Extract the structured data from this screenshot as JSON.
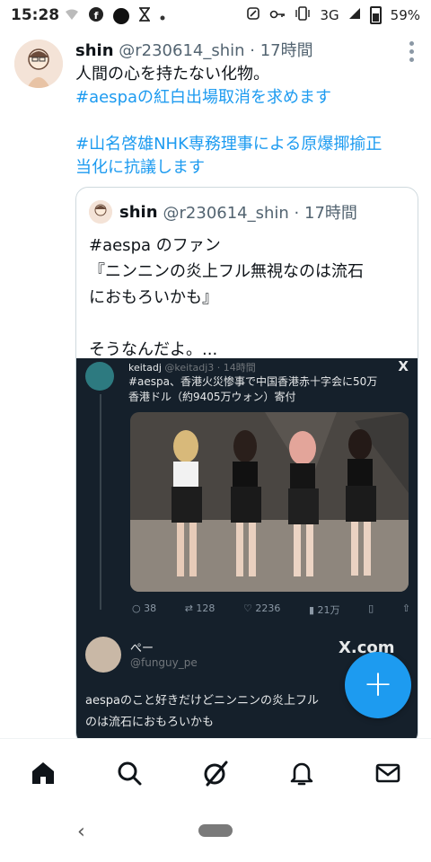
{
  "status_bar": {
    "time": "15:28",
    "network": "3G",
    "battery": "59%"
  },
  "tweet": {
    "author_name": "shin",
    "author_meta": "@r230614_shin · 17時間",
    "lines": [
      "人間の心を持たない化物。",
      "#aespaの紅白出場取消を求めます",
      "",
      "#山名啓雄NHK専務理事による原爆揶揄正",
      "当化に抗議します"
    ]
  },
  "quote": {
    "author_name": "shin",
    "author_meta": "@r230614_shin · 17時間",
    "lines": [
      "#aespa のファン",
      "『ニンニンの炎上フル無視なのは流石",
      "におもろいかも』",
      "",
      "そうなんだよ。..."
    ]
  },
  "embedded": {
    "author": "keitadj",
    "meta": "@keitadj3 · 14時間",
    "x_mark": "X",
    "text_lines": [
      "#aespa、香港火災惨事で中国香港赤十字会に50万",
      "香港ドル（約9405万ウォン）寄付"
    ],
    "actions": {
      "reply": "38",
      "retweet": "128",
      "like": "2236",
      "views": "21万"
    },
    "reply_name": "ぺー",
    "reply_handle": "@funguy_pe",
    "watermark": "X.com",
    "reply_lines": [
      "aespaのこと好きだけどニンニンの炎上フル",
      "のは流石におもろいかも"
    ]
  },
  "fab_label": "+",
  "colors": {
    "accent": "#1d9bf0",
    "text": "#0f1419",
    "muted": "#536471"
  }
}
